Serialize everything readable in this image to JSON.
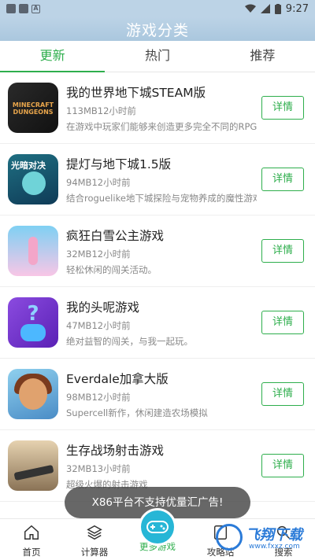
{
  "status_bar": {
    "time": "9:27"
  },
  "header": {
    "title": "游戏分类"
  },
  "tabs": [
    {
      "label": "更新",
      "active": true
    },
    {
      "label": "热门",
      "active": false
    },
    {
      "label": "推荐",
      "active": false
    }
  ],
  "games": [
    {
      "title": "我的世界地下城STEAM版",
      "meta": "113MB12小时前",
      "desc": "在游戏中玩家们能够来创造更多完全不同的RPG冒险",
      "button": "详情",
      "icon_label": "MINECRAFT DUNGEONS"
    },
    {
      "title": "提灯与地下城1.5版",
      "meta": "94MB12小时前",
      "desc": "结合roguelike地下城探险与宠物养成的魔性游戏!",
      "button": "详情",
      "icon_label": "光暗对决"
    },
    {
      "title": "疯狂白雪公主游戏",
      "meta": "32MB12小时前",
      "desc": "轻松休闲的闯关活动。",
      "button": "详情"
    },
    {
      "title": "我的头呢游戏",
      "meta": "47MB12小时前",
      "desc": "绝对益智的闯关，与我一起玩。",
      "button": "详情"
    },
    {
      "title": "Everdale加拿大版",
      "meta": "98MB12小时前",
      "desc": "Supercell新作，休闲建造农场模拟",
      "button": "详情"
    },
    {
      "title": "生存战场射击游戏",
      "meta": "32MB13小时前",
      "desc": "超级火爆的射击游戏",
      "button": "详情"
    }
  ],
  "toast": {
    "text": "X86平台不支持优量汇广告!"
  },
  "bottom_nav": [
    {
      "label": "首页",
      "icon": "home-icon",
      "active": false
    },
    {
      "label": "计算器",
      "icon": "layers-icon",
      "active": false
    },
    {
      "label": "更多游戏",
      "icon": "gamepad-icon",
      "active": true
    },
    {
      "label": "攻略站",
      "icon": "book-icon",
      "active": false
    },
    {
      "label": "搜索",
      "icon": "search-icon",
      "active": false
    }
  ],
  "watermark": {
    "brand": "飞翔下载",
    "url": "www.fxxz.com"
  },
  "colors": {
    "accent": "#2eae4c",
    "header": "#bcd3e6",
    "nav_bubble": "#27b6d6"
  }
}
